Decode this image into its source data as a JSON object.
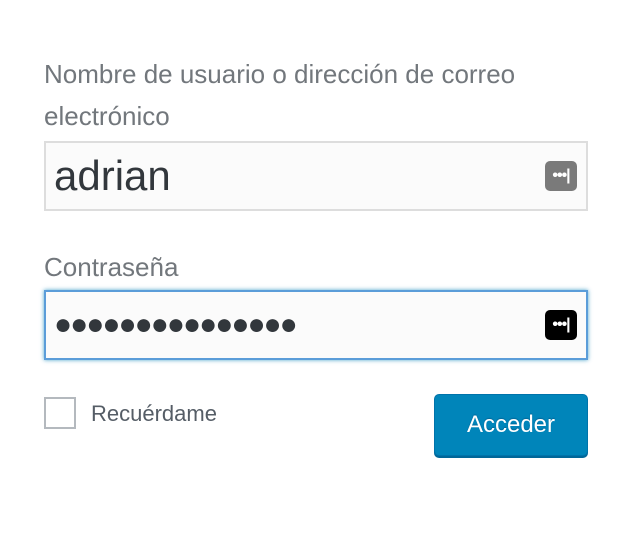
{
  "form": {
    "username_label": "Nombre de usuario o dirección de correo electrónico",
    "username_value": "adrian",
    "password_label": "Contraseña",
    "password_mask": "●●●●●●●●●●●●●●●",
    "password_manager_icon": "•••|",
    "remember_label": "Recuérdame",
    "remember_checked": false,
    "submit_label": "Acceder"
  },
  "icons": {
    "username_field_icon": "password-manager-icon",
    "password_field_icon": "password-manager-icon"
  },
  "colors": {
    "label": "#72777c",
    "field_text": "#32373c",
    "focus_border": "#5b9dd9",
    "button": "#0085ba",
    "button_text": "#ffffff"
  }
}
